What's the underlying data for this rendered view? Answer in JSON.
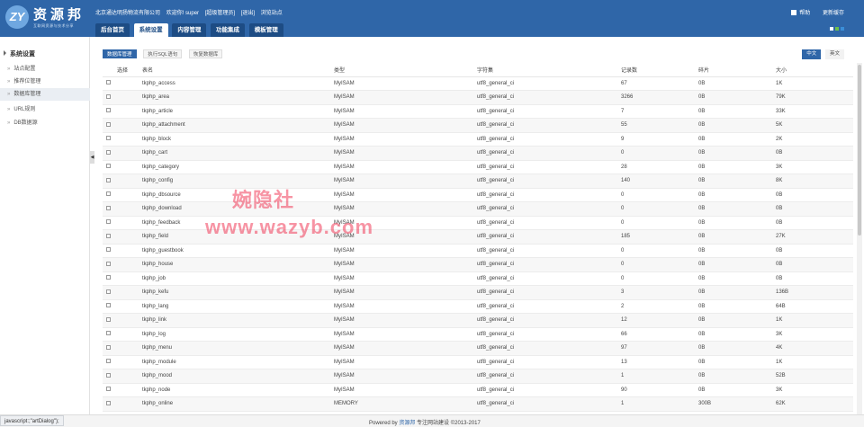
{
  "header": {
    "logo_mark": "ZY",
    "logo_text": "资源邦",
    "logo_sub": "互联网资源与技术分享",
    "company": "北京通达明扬物流有限公司",
    "welcome": "欢迎你! super",
    "role": "[超级管理员]",
    "logout": "[退出]",
    "site_link": "浏览站点",
    "right_link1": "帮助",
    "right_link2": "更新缓存",
    "tabs": [
      "后台首页",
      "系统设置",
      "内容管理",
      "功能集成",
      "模板管理"
    ]
  },
  "sidebar": {
    "title": "系统设置",
    "items": [
      "站点配置",
      "推荐位管理",
      "数据库管理",
      "URL规则",
      "DB数据源"
    ]
  },
  "toolbar": {
    "buttons": [
      "数据库管理",
      "执行SQL语句",
      "恢复数据库"
    ],
    "lang": [
      "中文",
      "英文"
    ]
  },
  "table": {
    "headers": [
      "选择",
      "表名",
      "类型",
      "字符集",
      "记录数",
      "碎片",
      "大小"
    ],
    "rows": [
      [
        "tkphp_access",
        "MyISAM",
        "utf8_general_ci",
        "67",
        "0B",
        "1K"
      ],
      [
        "tkphp_area",
        "MyISAM",
        "utf8_general_ci",
        "3266",
        "0B",
        "79K"
      ],
      [
        "tkphp_article",
        "MyISAM",
        "utf8_general_ci",
        "7",
        "0B",
        "33K"
      ],
      [
        "tkphp_attachment",
        "MyISAM",
        "utf8_general_ci",
        "55",
        "0B",
        "5K"
      ],
      [
        "tkphp_block",
        "MyISAM",
        "utf8_general_ci",
        "9",
        "0B",
        "2K"
      ],
      [
        "tkphp_cart",
        "MyISAM",
        "utf8_general_ci",
        "0",
        "0B",
        "0B"
      ],
      [
        "tkphp_category",
        "MyISAM",
        "utf8_general_ci",
        "28",
        "0B",
        "3K"
      ],
      [
        "tkphp_config",
        "MyISAM",
        "utf8_general_ci",
        "140",
        "0B",
        "8K"
      ],
      [
        "tkphp_dbsource",
        "MyISAM",
        "utf8_general_ci",
        "0",
        "0B",
        "0B"
      ],
      [
        "tkphp_download",
        "MyISAM",
        "utf8_general_ci",
        "0",
        "0B",
        "0B"
      ],
      [
        "tkphp_feedback",
        "MyISAM",
        "utf8_general_ci",
        "0",
        "0B",
        "0B"
      ],
      [
        "tkphp_field",
        "MyISAM",
        "utf8_general_ci",
        "185",
        "0B",
        "27K"
      ],
      [
        "tkphp_guestbook",
        "MyISAM",
        "utf8_general_ci",
        "0",
        "0B",
        "0B"
      ],
      [
        "tkphp_house",
        "MyISAM",
        "utf8_general_ci",
        "0",
        "0B",
        "0B"
      ],
      [
        "tkphp_job",
        "MyISAM",
        "utf8_general_ci",
        "0",
        "0B",
        "0B"
      ],
      [
        "tkphp_kefu",
        "MyISAM",
        "utf8_general_ci",
        "3",
        "0B",
        "136B"
      ],
      [
        "tkphp_lang",
        "MyISAM",
        "utf8_general_ci",
        "2",
        "0B",
        "64B"
      ],
      [
        "tkphp_link",
        "MyISAM",
        "utf8_general_ci",
        "12",
        "0B",
        "1K"
      ],
      [
        "tkphp_log",
        "MyISAM",
        "utf8_general_ci",
        "66",
        "0B",
        "3K"
      ],
      [
        "tkphp_menu",
        "MyISAM",
        "utf8_general_ci",
        "97",
        "0B",
        "4K"
      ],
      [
        "tkphp_module",
        "MyISAM",
        "utf8_general_ci",
        "13",
        "0B",
        "1K"
      ],
      [
        "tkphp_mood",
        "MyISAM",
        "utf8_general_ci",
        "1",
        "0B",
        "52B"
      ],
      [
        "tkphp_node",
        "MyISAM",
        "utf8_general_ci",
        "90",
        "0B",
        "3K"
      ],
      [
        "tkphp_online",
        "MEMORY",
        "utf8_general_ci",
        "1",
        "300B",
        "62K"
      ]
    ]
  },
  "watermark": {
    "line1": "婉隐社",
    "line2": "www.wazyb.com"
  },
  "footer": {
    "powered": "Powered by",
    "brand": "资源邦",
    "rest": "专注网站建设 ©2013-2017"
  },
  "statusbar": "javascript:;\"artDialog\");"
}
